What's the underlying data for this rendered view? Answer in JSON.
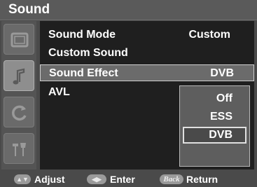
{
  "title": "Sound",
  "sidebar": {
    "items": [
      {
        "name": "picture-icon",
        "active": false
      },
      {
        "name": "music-note-icon",
        "active": true
      },
      {
        "name": "channel-icon",
        "active": false
      },
      {
        "name": "setup-tools-icon",
        "active": false
      }
    ]
  },
  "menu": {
    "items": [
      {
        "label": "Sound Mode",
        "value": "Custom"
      },
      {
        "label": "Custom Sound",
        "value": ""
      },
      {
        "label": "Sound Effect",
        "value": "DVB",
        "selected": true
      },
      {
        "label": "AVL",
        "value": ""
      }
    ]
  },
  "dropdown": {
    "options": [
      "Off",
      "ESS",
      "DVB"
    ],
    "selected": "DVB"
  },
  "footer": {
    "adjust": "Adjust",
    "enter": "Enter",
    "back_icon": "Back",
    "return": "Return"
  },
  "colors": {
    "panel": "#1f1f1f",
    "frame": "#4a4a4a",
    "highlight": "#6b6b6b",
    "text": "#ffffff"
  }
}
